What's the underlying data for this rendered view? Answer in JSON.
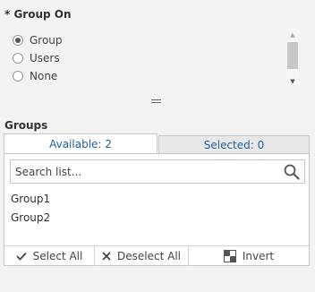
{
  "group_on": {
    "title": "* Group On",
    "options": [
      {
        "label": "Group",
        "checked": true
      },
      {
        "label": "Users",
        "checked": false
      },
      {
        "label": "None",
        "checked": false
      }
    ]
  },
  "groups": {
    "title": "Groups",
    "tabs": {
      "available": "Available: 2",
      "selected": "Selected: 0"
    },
    "search_placeholder": "Search list...",
    "items": [
      "Group1",
      "Group2"
    ],
    "actions": {
      "select_all": "Select All",
      "deselect_all": "Deselect All",
      "invert": "Invert"
    }
  },
  "colors": {
    "tab_text": "#1f5f9a",
    "panel_border": "#c8c8c8"
  }
}
